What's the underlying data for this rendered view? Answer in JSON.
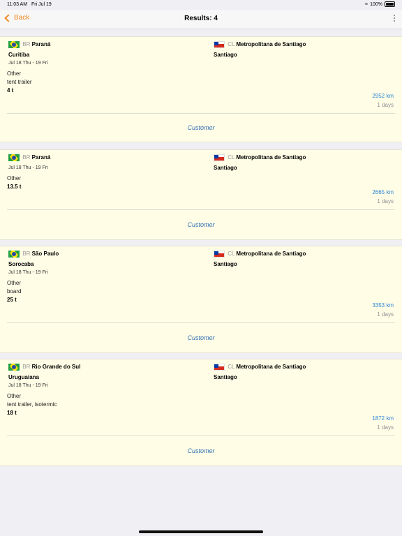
{
  "status": {
    "time": "11:03 AM",
    "date": "Fri Jul 19",
    "battery": "100%"
  },
  "nav": {
    "back": "Back",
    "title": "Results: 4"
  },
  "cards": [
    {
      "orig_code": "BR",
      "orig_region": "Paraná",
      "orig_city": "Curitiba",
      "dest_code": "CL",
      "dest_region": "Metropolitana de Santiago",
      "dest_city": "Santiago",
      "dates": "Jul 18 Thu - 19 Fri",
      "type": "Other",
      "body": "tent trailer",
      "weight": "4 t",
      "km": "2952 km",
      "days": "1 days",
      "customer": "Customer"
    },
    {
      "orig_code": "BR",
      "orig_region": "Paraná",
      "orig_city": "",
      "dest_code": "CL",
      "dest_region": "Metropolitana de Santiago",
      "dest_city": "Santiago",
      "dates": "Jul 18 Thu - 19 Fri",
      "type": "Other",
      "body": "",
      "weight": "13.5 t",
      "km": "2665 km",
      "days": "1 days",
      "customer": "Customer"
    },
    {
      "orig_code": "BR",
      "orig_region": "São Paulo",
      "orig_city": "Sorocaba",
      "dest_code": "CL",
      "dest_region": "Metropolitana de Santiago",
      "dest_city": "Santiago",
      "dates": "Jul 18 Thu - 19 Fri",
      "type": "Other",
      "body": "board",
      "weight": "25 t",
      "km": "3353 km",
      "days": "1 days",
      "customer": "Customer"
    },
    {
      "orig_code": "BR",
      "orig_region": "Rio Grande do Sul",
      "orig_city": "Uruguaiana",
      "dest_code": "CL",
      "dest_region": "Metropolitana de Santiago",
      "dest_city": "Santiago",
      "dates": "Jul 18 Thu - 19 Fri",
      "type": "Other",
      "body": "tent trailer, isotermic",
      "weight": "18 t",
      "km": "1872 km",
      "days": "1 days",
      "customer": "Customer"
    }
  ]
}
